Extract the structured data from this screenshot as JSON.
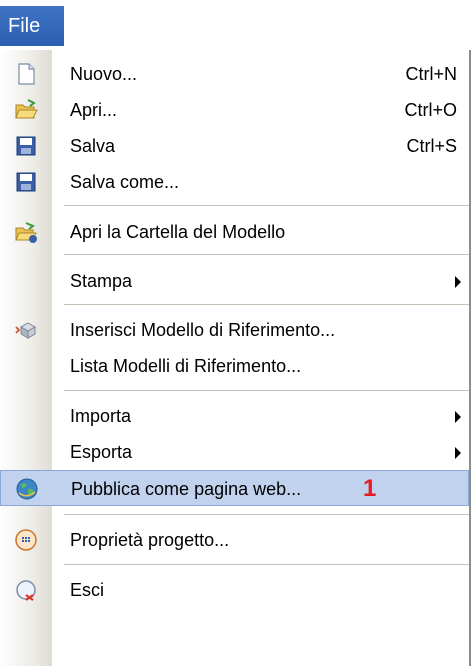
{
  "menubar": {
    "file_tab": "File"
  },
  "menu": {
    "items": [
      {
        "label": "Nuovo...",
        "shortcut": "Ctrl+N",
        "icon": "new-document-icon"
      },
      {
        "label": "Apri...",
        "shortcut": "Ctrl+O",
        "icon": "open-folder-icon"
      },
      {
        "label": "Salva",
        "shortcut": "Ctrl+S",
        "icon": "save-disk-icon"
      },
      {
        "label": "Salva come...",
        "icon": "save-as-disk-icon"
      },
      {
        "label": "Apri la Cartella del Modello",
        "icon": "open-model-folder-icon"
      },
      {
        "label": "Stampa",
        "has_submenu": true
      },
      {
        "label": "Inserisci Modello di Riferimento...",
        "icon": "insert-reference-icon"
      },
      {
        "label": "Lista Modelli di Riferimento..."
      },
      {
        "label": "Importa",
        "has_submenu": true
      },
      {
        "label": "Esporta",
        "has_submenu": true
      },
      {
        "label": "Pubblica come pagina web...",
        "icon": "globe-icon",
        "highlighted": true,
        "badge": "1"
      },
      {
        "label": "Proprietà progetto...",
        "icon": "project-properties-icon"
      },
      {
        "label": "Esci",
        "icon": "exit-icon"
      }
    ]
  },
  "colors": {
    "file_tab_bg": "#2d5fb0",
    "highlight_bg": "#c1d2ee",
    "badge": "#e51c1c"
  }
}
